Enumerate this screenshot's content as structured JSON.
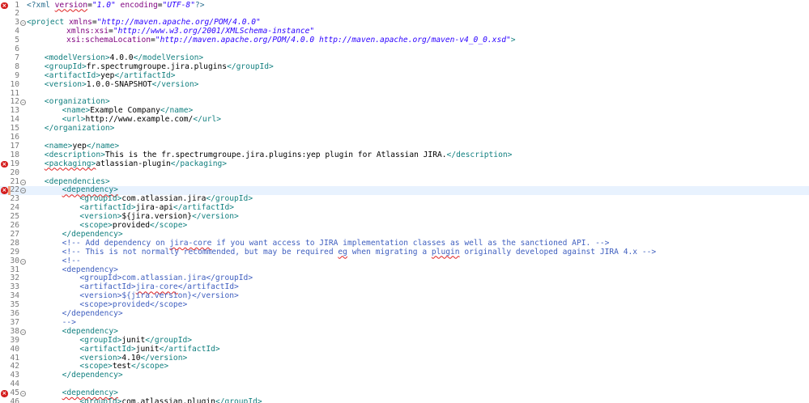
{
  "editor": {
    "current_line": 22,
    "lines": [
      {
        "n": 1,
        "indent": 0,
        "error": true,
        "fold": false,
        "parts": [
          [
            "pi",
            "<?xml "
          ],
          [
            "squig-attr",
            "version"
          ],
          [
            "txt",
            "="
          ],
          [
            "val",
            "\"1.0\""
          ],
          [
            "txt",
            " "
          ],
          [
            "attr",
            "encoding"
          ],
          [
            "txt",
            "="
          ],
          [
            "val",
            "\"UTF-8\""
          ],
          [
            "pi",
            "?>"
          ]
        ]
      },
      {
        "n": 2,
        "indent": 0,
        "parts": []
      },
      {
        "n": 3,
        "indent": 0,
        "fold": true,
        "parts": [
          [
            "tag",
            "<project"
          ],
          [
            "txt",
            " "
          ],
          [
            "attr",
            "xmlns"
          ],
          [
            "txt",
            "="
          ],
          [
            "val",
            "\"http://maven.apache.org/POM/4.0.0\""
          ]
        ]
      },
      {
        "n": 4,
        "indent": 9,
        "parts": [
          [
            "attr",
            "xmlns:xsi"
          ],
          [
            "txt",
            "="
          ],
          [
            "val",
            "\"http://www.w3.org/2001/XMLSchema-instance\""
          ]
        ]
      },
      {
        "n": 5,
        "indent": 9,
        "parts": [
          [
            "attr",
            "xsi:schemaLocation"
          ],
          [
            "txt",
            "="
          ],
          [
            "val",
            "\"http://maven.apache.org/POM/4.0.0 http://maven.apache.org/maven-v4_0_0.xsd\""
          ],
          [
            "tag",
            ">"
          ]
        ]
      },
      {
        "n": 6,
        "indent": 0,
        "parts": []
      },
      {
        "n": 7,
        "indent": 4,
        "parts": [
          [
            "tag",
            "<modelVersion>"
          ],
          [
            "txt",
            "4.0.0"
          ],
          [
            "tag",
            "</modelVersion>"
          ]
        ]
      },
      {
        "n": 8,
        "indent": 4,
        "parts": [
          [
            "tag",
            "<groupId>"
          ],
          [
            "txt",
            "fr.spectrumgroupe.jira.plugins"
          ],
          [
            "tag",
            "</groupId>"
          ]
        ]
      },
      {
        "n": 9,
        "indent": 4,
        "parts": [
          [
            "tag",
            "<artifactId>"
          ],
          [
            "txt",
            "yep"
          ],
          [
            "tag",
            "</artifactId>"
          ]
        ]
      },
      {
        "n": 10,
        "indent": 4,
        "parts": [
          [
            "tag",
            "<version>"
          ],
          [
            "txt",
            "1.0.0-SNAPSHOT"
          ],
          [
            "tag",
            "</version>"
          ]
        ]
      },
      {
        "n": 11,
        "indent": 0,
        "parts": []
      },
      {
        "n": 12,
        "indent": 4,
        "fold": true,
        "parts": [
          [
            "tag",
            "<organization>"
          ]
        ]
      },
      {
        "n": 13,
        "indent": 8,
        "parts": [
          [
            "tag",
            "<name>"
          ],
          [
            "txt",
            "Example Company"
          ],
          [
            "tag",
            "</name>"
          ]
        ]
      },
      {
        "n": 14,
        "indent": 8,
        "parts": [
          [
            "tag",
            "<url>"
          ],
          [
            "txt",
            "http://www.example.com/"
          ],
          [
            "tag",
            "</url>"
          ]
        ]
      },
      {
        "n": 15,
        "indent": 4,
        "parts": [
          [
            "tag",
            "</organization>"
          ]
        ]
      },
      {
        "n": 16,
        "indent": 0,
        "parts": []
      },
      {
        "n": 17,
        "indent": 4,
        "parts": [
          [
            "tag",
            "<name>"
          ],
          [
            "txt",
            "yep"
          ],
          [
            "tag",
            "</name>"
          ]
        ]
      },
      {
        "n": 18,
        "indent": 4,
        "parts": [
          [
            "tag",
            "<description>"
          ],
          [
            "txt",
            "This is the fr.spectrumgroupe.jira.plugins:yep plugin for Atlassian JIRA."
          ],
          [
            "tag",
            "</description>"
          ]
        ]
      },
      {
        "n": 19,
        "indent": 4,
        "error": true,
        "parts": [
          [
            "squig-tag",
            "<packaging>"
          ],
          [
            "txt",
            "atlassian-plugin"
          ],
          [
            "tag",
            "</packaging>"
          ]
        ]
      },
      {
        "n": 20,
        "indent": 0,
        "parts": []
      },
      {
        "n": 21,
        "indent": 4,
        "fold": true,
        "parts": [
          [
            "tag",
            "<dependencies>"
          ]
        ]
      },
      {
        "n": 22,
        "indent": 8,
        "error": true,
        "fold": true,
        "mark": true,
        "parts": [
          [
            "squig-tag",
            "<dependency>"
          ]
        ]
      },
      {
        "n": 23,
        "indent": 12,
        "parts": [
          [
            "tag",
            "<groupId>"
          ],
          [
            "txt",
            "com.atlassian.jira"
          ],
          [
            "tag",
            "</groupId>"
          ]
        ]
      },
      {
        "n": 24,
        "indent": 12,
        "parts": [
          [
            "tag",
            "<artifactId>"
          ],
          [
            "txt",
            "jira-api"
          ],
          [
            "tag",
            "</artifactId>"
          ]
        ]
      },
      {
        "n": 25,
        "indent": 12,
        "parts": [
          [
            "tag",
            "<version>"
          ],
          [
            "txt",
            "${jira.version}"
          ],
          [
            "tag",
            "</version>"
          ]
        ]
      },
      {
        "n": 26,
        "indent": 12,
        "parts": [
          [
            "tag",
            "<scope>"
          ],
          [
            "txt",
            "provided"
          ],
          [
            "tag",
            "</scope>"
          ]
        ]
      },
      {
        "n": 27,
        "indent": 8,
        "parts": [
          [
            "tag",
            "</dependency>"
          ]
        ]
      },
      {
        "n": 28,
        "indent": 8,
        "parts": [
          [
            "cmt",
            "<!-- Add dependency on "
          ],
          [
            "squig-cmt",
            "jira-core"
          ],
          [
            "cmt",
            " if you want access to JIRA implementation classes as well as the sanctioned API. -->"
          ]
        ]
      },
      {
        "n": 29,
        "indent": 8,
        "parts": [
          [
            "cmt",
            "<!-- This is not normally recommended, but may be required "
          ],
          [
            "squig-cmt",
            "eg"
          ],
          [
            "cmt",
            " when migrating a "
          ],
          [
            "squig-cmt",
            "plugin"
          ],
          [
            "cmt",
            " originally developed against JIRA 4.x -->"
          ]
        ]
      },
      {
        "n": 30,
        "indent": 8,
        "fold": true,
        "parts": [
          [
            "cmt",
            "<!--"
          ]
        ]
      },
      {
        "n": 31,
        "indent": 8,
        "parts": [
          [
            "cmt",
            "<dependency>"
          ]
        ]
      },
      {
        "n": 32,
        "indent": 12,
        "parts": [
          [
            "cmt",
            "<groupId>com.atlassian.jira</groupId>"
          ]
        ]
      },
      {
        "n": 33,
        "indent": 12,
        "parts": [
          [
            "cmt",
            "<artifactId>"
          ],
          [
            "squig-cmt",
            "jira-core"
          ],
          [
            "cmt",
            "</artifactId>"
          ]
        ]
      },
      {
        "n": 34,
        "indent": 12,
        "parts": [
          [
            "cmt",
            "<version>${jira.version}</version>"
          ]
        ]
      },
      {
        "n": 35,
        "indent": 12,
        "parts": [
          [
            "cmt",
            "<scope>provided</scope>"
          ]
        ]
      },
      {
        "n": 36,
        "indent": 8,
        "parts": [
          [
            "cmt",
            "</dependency>"
          ]
        ]
      },
      {
        "n": 37,
        "indent": 8,
        "parts": [
          [
            "cmt",
            "-->"
          ]
        ]
      },
      {
        "n": 38,
        "indent": 8,
        "fold": true,
        "parts": [
          [
            "tag",
            "<dependency>"
          ]
        ]
      },
      {
        "n": 39,
        "indent": 12,
        "parts": [
          [
            "tag",
            "<groupId>"
          ],
          [
            "txt",
            "junit"
          ],
          [
            "tag",
            "</groupId>"
          ]
        ]
      },
      {
        "n": 40,
        "indent": 12,
        "parts": [
          [
            "tag",
            "<artifactId>"
          ],
          [
            "txt",
            "junit"
          ],
          [
            "tag",
            "</artifactId>"
          ]
        ]
      },
      {
        "n": 41,
        "indent": 12,
        "parts": [
          [
            "tag",
            "<version>"
          ],
          [
            "txt",
            "4.10"
          ],
          [
            "tag",
            "</version>"
          ]
        ]
      },
      {
        "n": 42,
        "indent": 12,
        "parts": [
          [
            "tag",
            "<scope>"
          ],
          [
            "txt",
            "test"
          ],
          [
            "tag",
            "</scope>"
          ]
        ]
      },
      {
        "n": 43,
        "indent": 8,
        "parts": [
          [
            "tag",
            "</dependency>"
          ]
        ]
      },
      {
        "n": 44,
        "indent": 0,
        "parts": []
      },
      {
        "n": 45,
        "indent": 8,
        "error": true,
        "fold": true,
        "parts": [
          [
            "squig-tag",
            "<dependency>"
          ]
        ]
      },
      {
        "n": 46,
        "indent": 12,
        "parts": [
          [
            "tag",
            "<groupId>"
          ],
          [
            "txt",
            "com.atlassian.plugin"
          ],
          [
            "tag",
            "</groupId>"
          ]
        ]
      }
    ]
  },
  "icons": {
    "error": "error-icon",
    "fold": "fold-toggle-icon"
  },
  "colors": {
    "tag": "#117f7f",
    "attribute": "#7f007f",
    "value": "#2a00ff",
    "comment": "#3f5fbf",
    "error": "#d41d1d",
    "current_line": "#e8f2fe"
  }
}
